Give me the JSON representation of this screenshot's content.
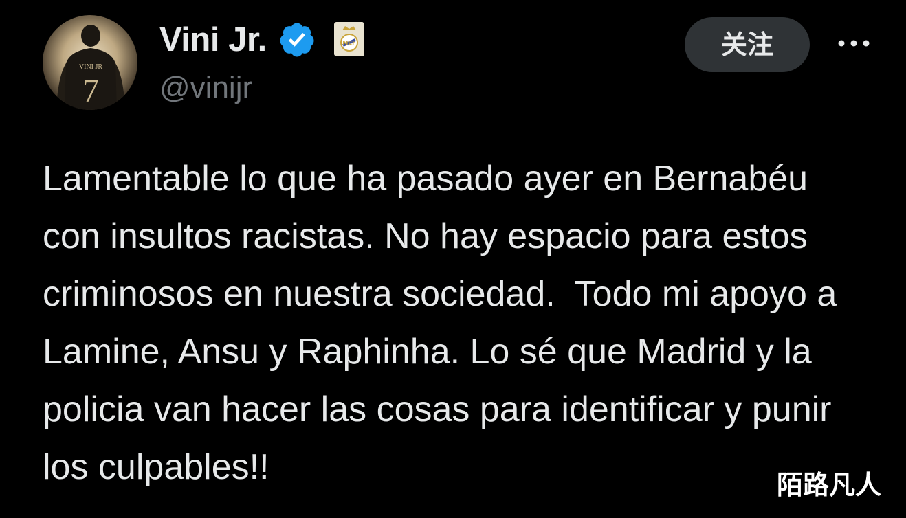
{
  "author": {
    "display_name": "Vini Jr.",
    "handle": "@vinijr",
    "verified": true,
    "avatar_icon": "avatar-player-number-7",
    "badge_icon": "real-madrid-crest-icon"
  },
  "actions": {
    "follow_label": "关注",
    "more_icon": "more-dots-icon"
  },
  "tweet": {
    "text": "Lamentable lo que ha pasado ayer en Bernabéu con insultos racistas. No hay espacio para estos criminosos en nuestra sociedad.  Todo mi apoyo a Lamine, Ansu y Raphinha. Lo sé que Madrid y la policia van hacer las cosas para identificar y punir los culpables!!"
  },
  "watermark": {
    "text": "陌路凡人"
  },
  "colors": {
    "background": "#000000",
    "text_primary": "#e7e9ea",
    "text_secondary": "#71767b",
    "verified_blue": "#1d9bf0",
    "button_bg": "#2f3336"
  }
}
